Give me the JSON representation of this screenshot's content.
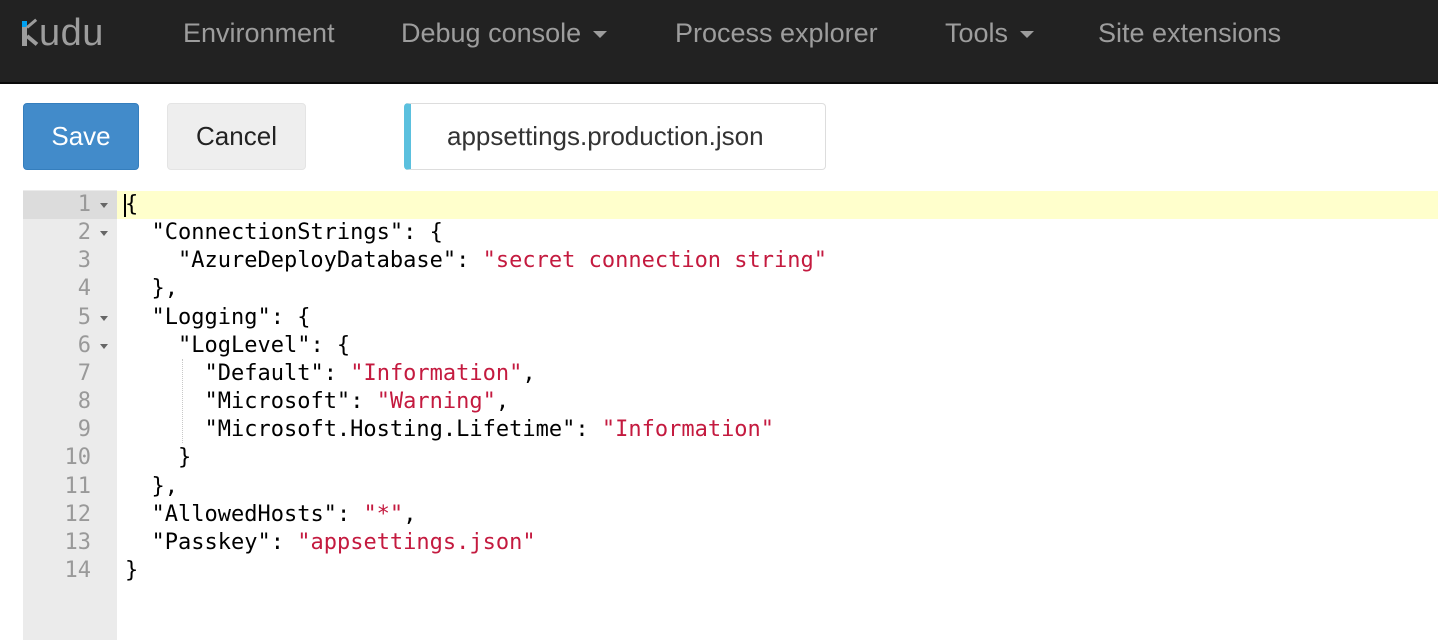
{
  "navbar": {
    "brand": "udu",
    "items": [
      {
        "label": "Environment"
      },
      {
        "label": "Debug console"
      },
      {
        "label": "Process explorer"
      },
      {
        "label": "Tools"
      },
      {
        "label": "Site extensions"
      }
    ]
  },
  "toolbar": {
    "save_label": "Save",
    "cancel_label": "Cancel",
    "filename": "appsettings.production.json"
  },
  "editor": {
    "line_numbers": [
      "1",
      "2",
      "3",
      "4",
      "5",
      "6",
      "7",
      "8",
      "9",
      "10",
      "11",
      "12",
      "13",
      "14"
    ],
    "lines": [
      {
        "indent": "",
        "key": "",
        "sep": "{",
        "value": "",
        "tail": ""
      },
      {
        "indent": "  ",
        "key": "\"ConnectionStrings\"",
        "sep": ": {",
        "value": "",
        "tail": ""
      },
      {
        "indent": "    ",
        "key": "\"AzureDeployDatabase\"",
        "sep": ": ",
        "value": "\"secret connection string\"",
        "tail": ""
      },
      {
        "indent": "  ",
        "key": "",
        "sep": "},",
        "value": "",
        "tail": ""
      },
      {
        "indent": "  ",
        "key": "\"Logging\"",
        "sep": ": {",
        "value": "",
        "tail": ""
      },
      {
        "indent": "    ",
        "key": "\"LogLevel\"",
        "sep": ": {",
        "value": "",
        "tail": ""
      },
      {
        "indent": "      ",
        "key": "\"Default\"",
        "sep": ": ",
        "value": "\"Information\"",
        "tail": ","
      },
      {
        "indent": "      ",
        "key": "\"Microsoft\"",
        "sep": ": ",
        "value": "\"Warning\"",
        "tail": ","
      },
      {
        "indent": "      ",
        "key": "\"Microsoft.Hosting.Lifetime\"",
        "sep": ": ",
        "value": "\"Information\"",
        "tail": ""
      },
      {
        "indent": "    ",
        "key": "",
        "sep": "}",
        "value": "",
        "tail": ""
      },
      {
        "indent": "  ",
        "key": "",
        "sep": "},",
        "value": "",
        "tail": ""
      },
      {
        "indent": "  ",
        "key": "\"AllowedHosts\"",
        "sep": ": ",
        "value": "\"*\"",
        "tail": ","
      },
      {
        "indent": "  ",
        "key": "\"Passkey\"",
        "sep": ": ",
        "value": "\"appsettings.json\"",
        "tail": ""
      },
      {
        "indent": "",
        "key": "",
        "sep": "}",
        "value": "",
        "tail": ""
      }
    ]
  }
}
